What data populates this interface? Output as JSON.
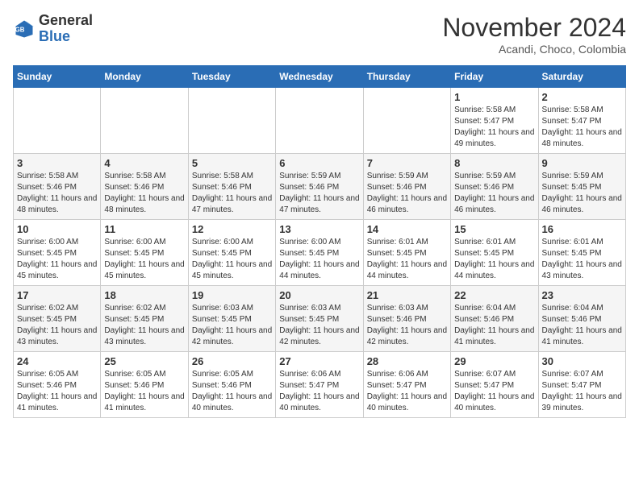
{
  "header": {
    "logo_general": "General",
    "logo_blue": "Blue",
    "month_year": "November 2024",
    "location": "Acandi, Choco, Colombia"
  },
  "weekdays": [
    "Sunday",
    "Monday",
    "Tuesday",
    "Wednesday",
    "Thursday",
    "Friday",
    "Saturday"
  ],
  "rows": [
    [
      {
        "day": "",
        "sunrise": "",
        "sunset": "",
        "daylight": ""
      },
      {
        "day": "",
        "sunrise": "",
        "sunset": "",
        "daylight": ""
      },
      {
        "day": "",
        "sunrise": "",
        "sunset": "",
        "daylight": ""
      },
      {
        "day": "",
        "sunrise": "",
        "sunset": "",
        "daylight": ""
      },
      {
        "day": "",
        "sunrise": "",
        "sunset": "",
        "daylight": ""
      },
      {
        "day": "1",
        "sunrise": "Sunrise: 5:58 AM",
        "sunset": "Sunset: 5:47 PM",
        "daylight": "Daylight: 11 hours and 49 minutes."
      },
      {
        "day": "2",
        "sunrise": "Sunrise: 5:58 AM",
        "sunset": "Sunset: 5:47 PM",
        "daylight": "Daylight: 11 hours and 48 minutes."
      }
    ],
    [
      {
        "day": "3",
        "sunrise": "Sunrise: 5:58 AM",
        "sunset": "Sunset: 5:46 PM",
        "daylight": "Daylight: 11 hours and 48 minutes."
      },
      {
        "day": "4",
        "sunrise": "Sunrise: 5:58 AM",
        "sunset": "Sunset: 5:46 PM",
        "daylight": "Daylight: 11 hours and 48 minutes."
      },
      {
        "day": "5",
        "sunrise": "Sunrise: 5:58 AM",
        "sunset": "Sunset: 5:46 PM",
        "daylight": "Daylight: 11 hours and 47 minutes."
      },
      {
        "day": "6",
        "sunrise": "Sunrise: 5:59 AM",
        "sunset": "Sunset: 5:46 PM",
        "daylight": "Daylight: 11 hours and 47 minutes."
      },
      {
        "day": "7",
        "sunrise": "Sunrise: 5:59 AM",
        "sunset": "Sunset: 5:46 PM",
        "daylight": "Daylight: 11 hours and 46 minutes."
      },
      {
        "day": "8",
        "sunrise": "Sunrise: 5:59 AM",
        "sunset": "Sunset: 5:46 PM",
        "daylight": "Daylight: 11 hours and 46 minutes."
      },
      {
        "day": "9",
        "sunrise": "Sunrise: 5:59 AM",
        "sunset": "Sunset: 5:45 PM",
        "daylight": "Daylight: 11 hours and 46 minutes."
      }
    ],
    [
      {
        "day": "10",
        "sunrise": "Sunrise: 6:00 AM",
        "sunset": "Sunset: 5:45 PM",
        "daylight": "Daylight: 11 hours and 45 minutes."
      },
      {
        "day": "11",
        "sunrise": "Sunrise: 6:00 AM",
        "sunset": "Sunset: 5:45 PM",
        "daylight": "Daylight: 11 hours and 45 minutes."
      },
      {
        "day": "12",
        "sunrise": "Sunrise: 6:00 AM",
        "sunset": "Sunset: 5:45 PM",
        "daylight": "Daylight: 11 hours and 45 minutes."
      },
      {
        "day": "13",
        "sunrise": "Sunrise: 6:00 AM",
        "sunset": "Sunset: 5:45 PM",
        "daylight": "Daylight: 11 hours and 44 minutes."
      },
      {
        "day": "14",
        "sunrise": "Sunrise: 6:01 AM",
        "sunset": "Sunset: 5:45 PM",
        "daylight": "Daylight: 11 hours and 44 minutes."
      },
      {
        "day": "15",
        "sunrise": "Sunrise: 6:01 AM",
        "sunset": "Sunset: 5:45 PM",
        "daylight": "Daylight: 11 hours and 44 minutes."
      },
      {
        "day": "16",
        "sunrise": "Sunrise: 6:01 AM",
        "sunset": "Sunset: 5:45 PM",
        "daylight": "Daylight: 11 hours and 43 minutes."
      }
    ],
    [
      {
        "day": "17",
        "sunrise": "Sunrise: 6:02 AM",
        "sunset": "Sunset: 5:45 PM",
        "daylight": "Daylight: 11 hours and 43 minutes."
      },
      {
        "day": "18",
        "sunrise": "Sunrise: 6:02 AM",
        "sunset": "Sunset: 5:45 PM",
        "daylight": "Daylight: 11 hours and 43 minutes."
      },
      {
        "day": "19",
        "sunrise": "Sunrise: 6:03 AM",
        "sunset": "Sunset: 5:45 PM",
        "daylight": "Daylight: 11 hours and 42 minutes."
      },
      {
        "day": "20",
        "sunrise": "Sunrise: 6:03 AM",
        "sunset": "Sunset: 5:45 PM",
        "daylight": "Daylight: 11 hours and 42 minutes."
      },
      {
        "day": "21",
        "sunrise": "Sunrise: 6:03 AM",
        "sunset": "Sunset: 5:46 PM",
        "daylight": "Daylight: 11 hours and 42 minutes."
      },
      {
        "day": "22",
        "sunrise": "Sunrise: 6:04 AM",
        "sunset": "Sunset: 5:46 PM",
        "daylight": "Daylight: 11 hours and 41 minutes."
      },
      {
        "day": "23",
        "sunrise": "Sunrise: 6:04 AM",
        "sunset": "Sunset: 5:46 PM",
        "daylight": "Daylight: 11 hours and 41 minutes."
      }
    ],
    [
      {
        "day": "24",
        "sunrise": "Sunrise: 6:05 AM",
        "sunset": "Sunset: 5:46 PM",
        "daylight": "Daylight: 11 hours and 41 minutes."
      },
      {
        "day": "25",
        "sunrise": "Sunrise: 6:05 AM",
        "sunset": "Sunset: 5:46 PM",
        "daylight": "Daylight: 11 hours and 41 minutes."
      },
      {
        "day": "26",
        "sunrise": "Sunrise: 6:05 AM",
        "sunset": "Sunset: 5:46 PM",
        "daylight": "Daylight: 11 hours and 40 minutes."
      },
      {
        "day": "27",
        "sunrise": "Sunrise: 6:06 AM",
        "sunset": "Sunset: 5:47 PM",
        "daylight": "Daylight: 11 hours and 40 minutes."
      },
      {
        "day": "28",
        "sunrise": "Sunrise: 6:06 AM",
        "sunset": "Sunset: 5:47 PM",
        "daylight": "Daylight: 11 hours and 40 minutes."
      },
      {
        "day": "29",
        "sunrise": "Sunrise: 6:07 AM",
        "sunset": "Sunset: 5:47 PM",
        "daylight": "Daylight: 11 hours and 40 minutes."
      },
      {
        "day": "30",
        "sunrise": "Sunrise: 6:07 AM",
        "sunset": "Sunset: 5:47 PM",
        "daylight": "Daylight: 11 hours and 39 minutes."
      }
    ]
  ]
}
